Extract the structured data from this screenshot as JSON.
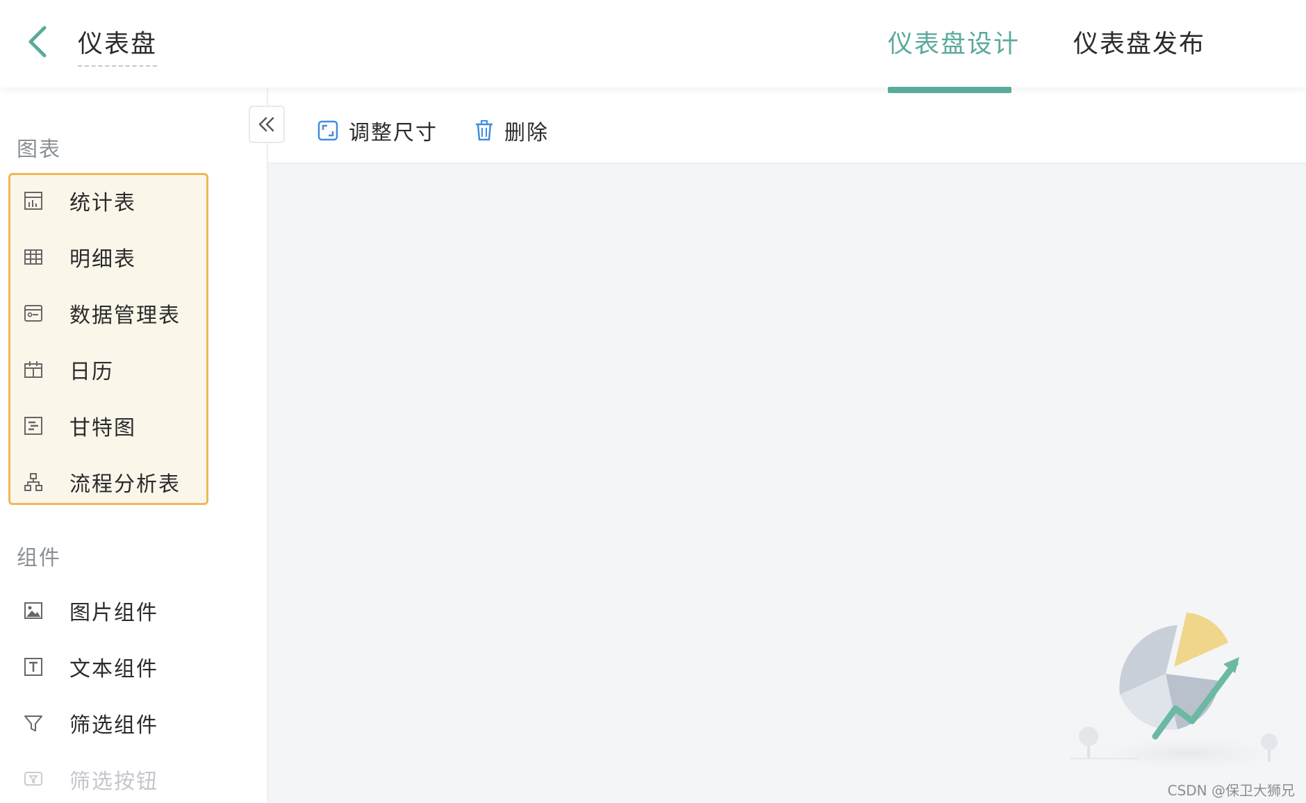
{
  "header": {
    "title": "仪表盘",
    "tabs": [
      {
        "label": "仪表盘设计",
        "active": true
      },
      {
        "label": "仪表盘发布",
        "active": false
      }
    ],
    "accent_color": "#5aaa9c"
  },
  "sidebar": {
    "charts_section": {
      "title": "图表",
      "items": [
        {
          "label": "统计表",
          "icon": "stat-table-icon"
        },
        {
          "label": "明细表",
          "icon": "grid-table-icon"
        },
        {
          "label": "数据管理表",
          "icon": "data-manage-icon"
        },
        {
          "label": "日历",
          "icon": "calendar-icon"
        },
        {
          "label": "甘特图",
          "icon": "gantt-icon"
        },
        {
          "label": "流程分析表",
          "icon": "flow-icon"
        }
      ],
      "highlight_color": "#f1b65a"
    },
    "components_section": {
      "title": "组件",
      "items": [
        {
          "label": "图片组件",
          "icon": "image-icon"
        },
        {
          "label": "文本组件",
          "icon": "text-icon"
        },
        {
          "label": "筛选组件",
          "icon": "filter-icon"
        },
        {
          "label": "筛选按钮",
          "icon": "filter-button-icon",
          "disabled": true
        }
      ]
    }
  },
  "toolbar": {
    "resize_label": "调整尺寸",
    "delete_label": "删除"
  },
  "watermark": "CSDN @保卫大狮兄"
}
